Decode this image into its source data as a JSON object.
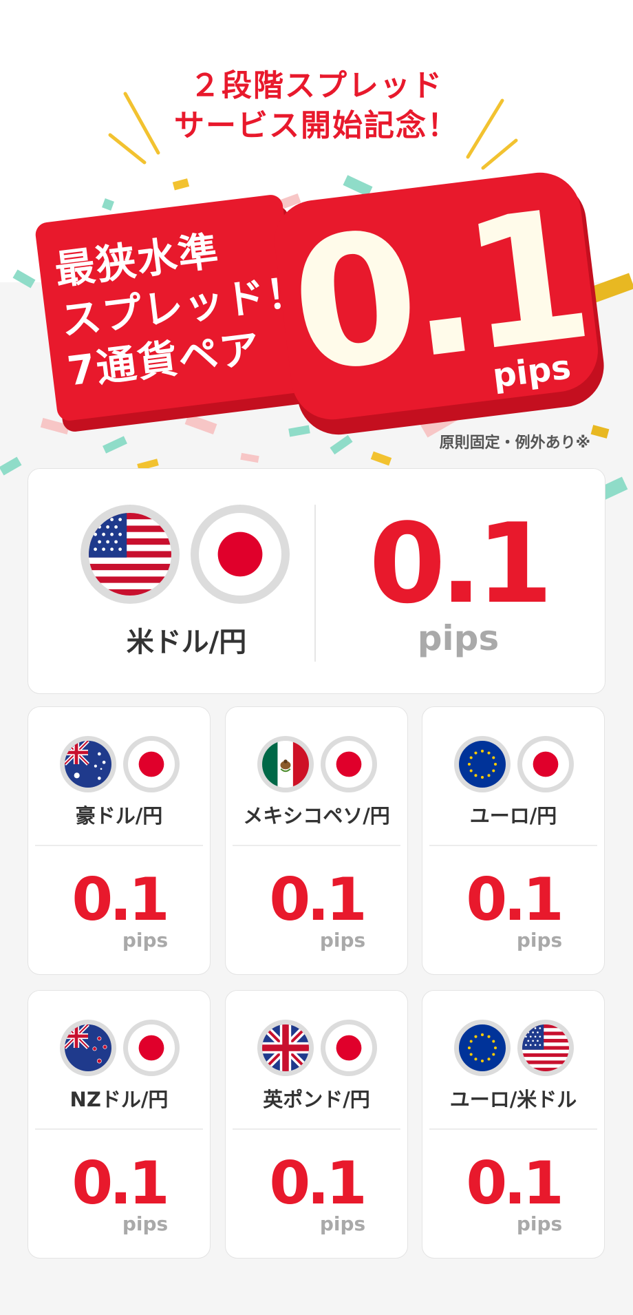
{
  "campaign": {
    "sub_headline_line1": "２段階スプレッド",
    "sub_headline_line2": "サービス開始記念！",
    "hero_line1": "最狭水準",
    "hero_line2": "スプレッド！",
    "hero_line3": "7通貨ペア",
    "hero_value": "0.1",
    "hero_unit": "pips",
    "note": "原則固定・例外あり※"
  },
  "featured_pair": {
    "pair": "米ドル/円",
    "value": "0.1",
    "unit": "pips",
    "flags": [
      "us-flag-icon",
      "japan-flag-icon"
    ]
  },
  "pairs": [
    {
      "pair": "豪ドル/円",
      "value": "0.1",
      "unit": "pips",
      "flags": [
        "australia-flag-icon",
        "japan-flag-icon"
      ]
    },
    {
      "pair": "メキシコペソ/円",
      "value": "0.1",
      "unit": "pips",
      "flags": [
        "mexico-flag-icon",
        "japan-flag-icon"
      ]
    },
    {
      "pair": "ユーロ/円",
      "value": "0.1",
      "unit": "pips",
      "flags": [
        "eu-flag-icon",
        "japan-flag-icon"
      ]
    },
    {
      "pair": "NZドル/円",
      "value": "0.1",
      "unit": "pips",
      "flags": [
        "new-zealand-flag-icon",
        "japan-flag-icon"
      ]
    },
    {
      "pair": "英ポンド/円",
      "value": "0.1",
      "unit": "pips",
      "flags": [
        "uk-flag-icon",
        "japan-flag-icon"
      ]
    },
    {
      "pair": "ユーロ/米ドル",
      "value": "0.1",
      "unit": "pips",
      "flags": [
        "eu-flag-icon",
        "us-flag-icon"
      ]
    }
  ],
  "colors": {
    "brand_red": "#e8192c",
    "unit_gray": "#a9a9a9",
    "text_dark": "#333333"
  }
}
